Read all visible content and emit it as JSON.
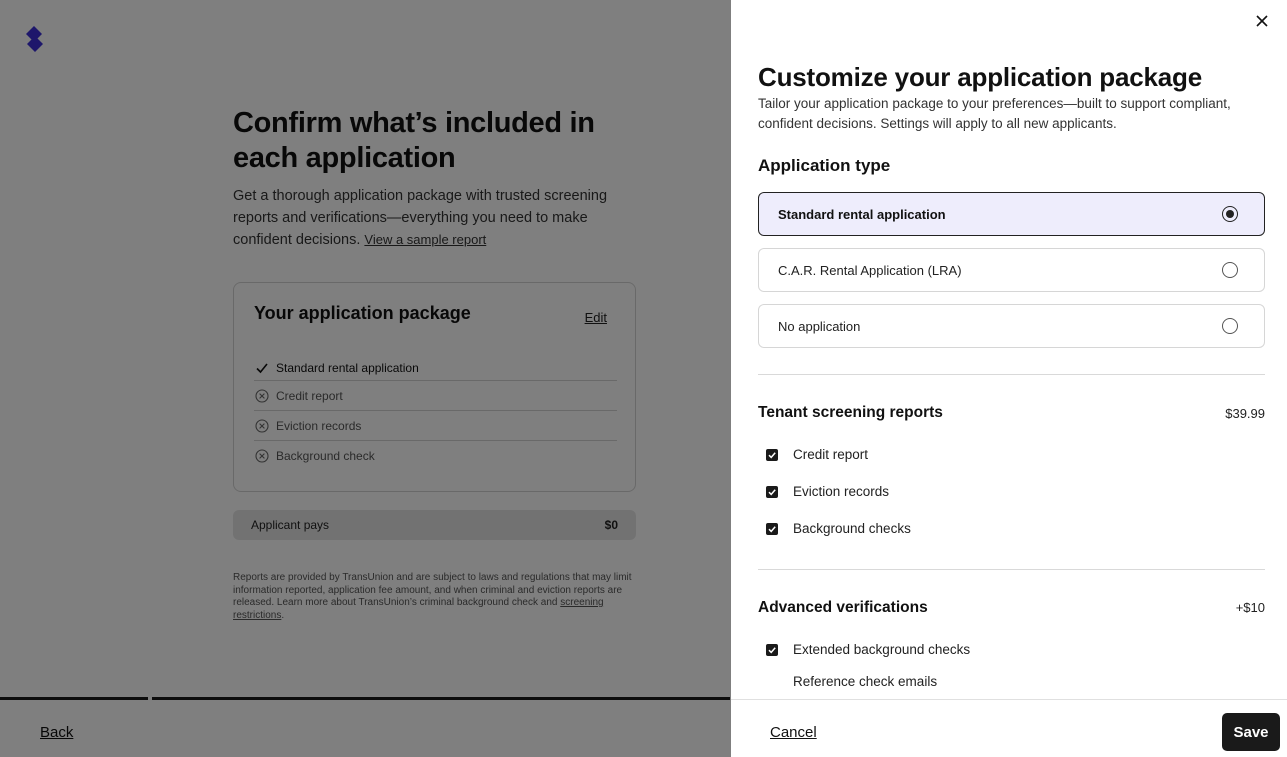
{
  "background": {
    "title": "Confirm what’s included in each application",
    "description": "Get a thorough application package with trusted screening reports and verifications—everything you need to make confident decisions.",
    "sample_link": "View a sample report",
    "package_card": {
      "title": "Your application package",
      "edit_label": "Edit",
      "items": [
        {
          "label": "Standard rental application",
          "status": "included"
        },
        {
          "label": "Credit report",
          "status": "excluded"
        },
        {
          "label": "Eviction records",
          "status": "excluded"
        },
        {
          "label": "Background check",
          "status": "excluded"
        }
      ]
    },
    "applicant_pays": {
      "label": "Applicant pays",
      "value": "$0"
    },
    "footnote": "Reports are provided by TransUnion and are subject to laws and regulations that may limit information reported, application fee amount, and when criminal and eviction reports are released. Learn more about TransUnion’s criminal background check and",
    "footnote_link": "screening restrictions",
    "back_label": "Back"
  },
  "drawer": {
    "title": "Customize your application package",
    "subtitle": "Tailor your application package to your preferences—built to support compliant, confident decisions. Settings will apply to all new applicants.",
    "application_type": {
      "title": "Application type",
      "options": [
        {
          "label": "Standard rental application",
          "selected": true
        },
        {
          "label": "C.A.R. Rental Application (LRA)",
          "selected": false
        },
        {
          "label": "No application",
          "selected": false
        }
      ]
    },
    "screening": {
      "title": "Tenant screening reports",
      "price": "$39.99",
      "items": [
        {
          "label": "Credit report",
          "checked": true
        },
        {
          "label": "Eviction records",
          "checked": true
        },
        {
          "label": "Background checks",
          "checked": true
        }
      ]
    },
    "advanced": {
      "title": "Advanced verifications",
      "price": "+$10",
      "items": [
        {
          "label": "Extended background checks",
          "checked": true
        },
        {
          "label": "Reference check emails",
          "checked": false
        }
      ]
    },
    "cancel_label": "Cancel",
    "save_label": "Save"
  },
  "colors": {
    "logo": "#3d2fd6",
    "selected_bg": "#eeedfc",
    "primary_button": "#1a1a1a"
  }
}
